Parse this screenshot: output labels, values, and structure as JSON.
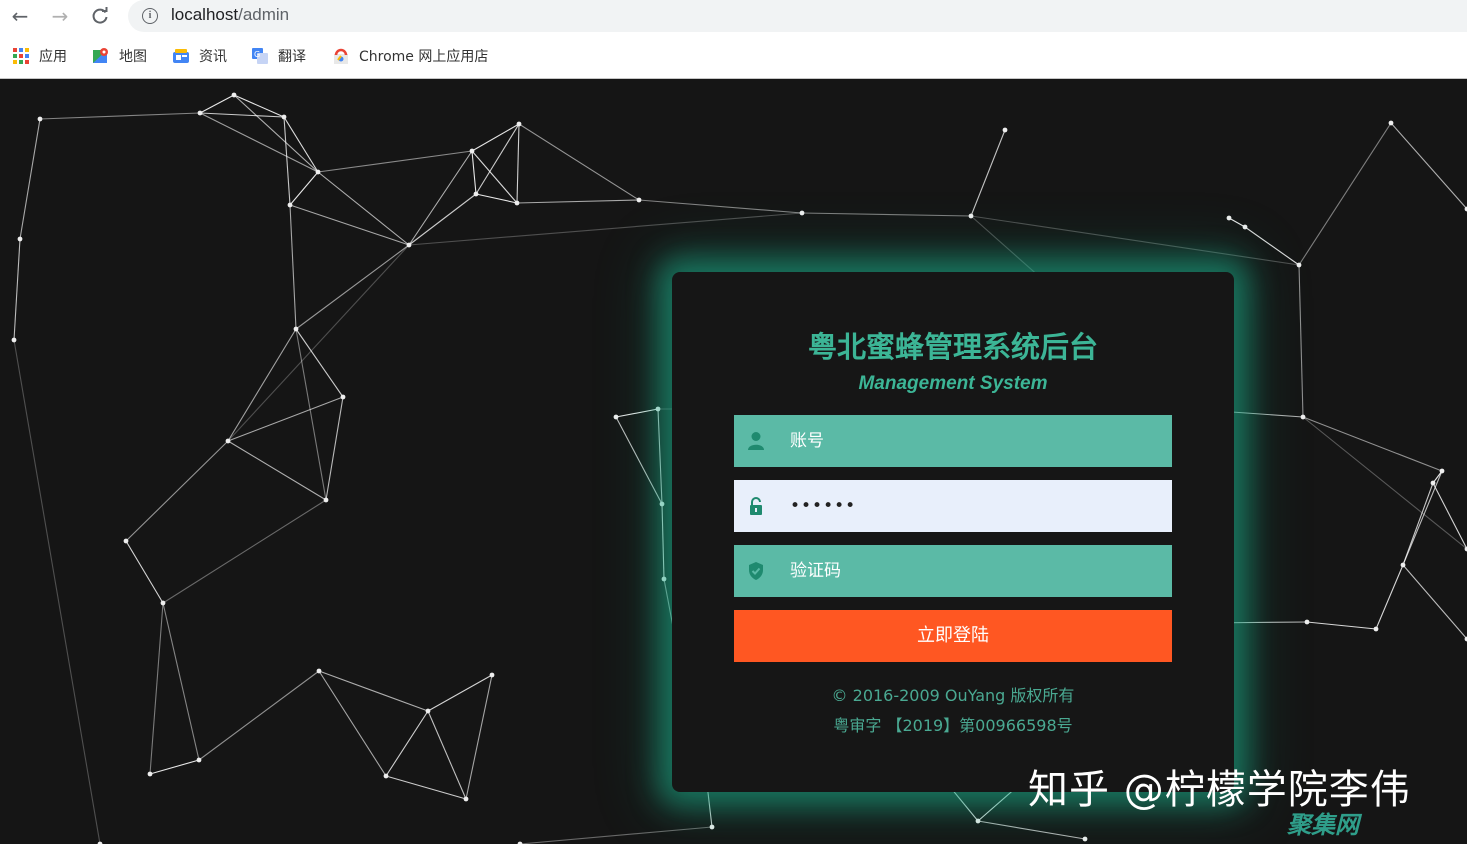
{
  "browser": {
    "url_host": "localhost",
    "url_path": "/admin",
    "bookmarks": [
      {
        "label": "应用",
        "icon": "apps-grid-icon"
      },
      {
        "label": "地图",
        "icon": "maps-icon"
      },
      {
        "label": "资讯",
        "icon": "news-icon"
      },
      {
        "label": "翻译",
        "icon": "translate-icon"
      },
      {
        "label": "Chrome 网上应用店",
        "icon": "web-store-icon"
      }
    ]
  },
  "login": {
    "title": "粤北蜜蜂管理系统后台",
    "subtitle": "Management System",
    "username_placeholder": "账号",
    "password_value": "••••••",
    "captcha_placeholder": "验证码",
    "submit_label": "立即登陆",
    "copyright": "© 2016-2009 OuYang 版权所有",
    "icp": "粤审字 【2019】第00966598号"
  },
  "watermark": {
    "text": "知乎 @柠檬学院李伟",
    "sub": "聚集网"
  },
  "colors": {
    "accent": "#5bbaa6",
    "title": "#3cb596",
    "button": "#ff5722",
    "background": "#151515"
  }
}
